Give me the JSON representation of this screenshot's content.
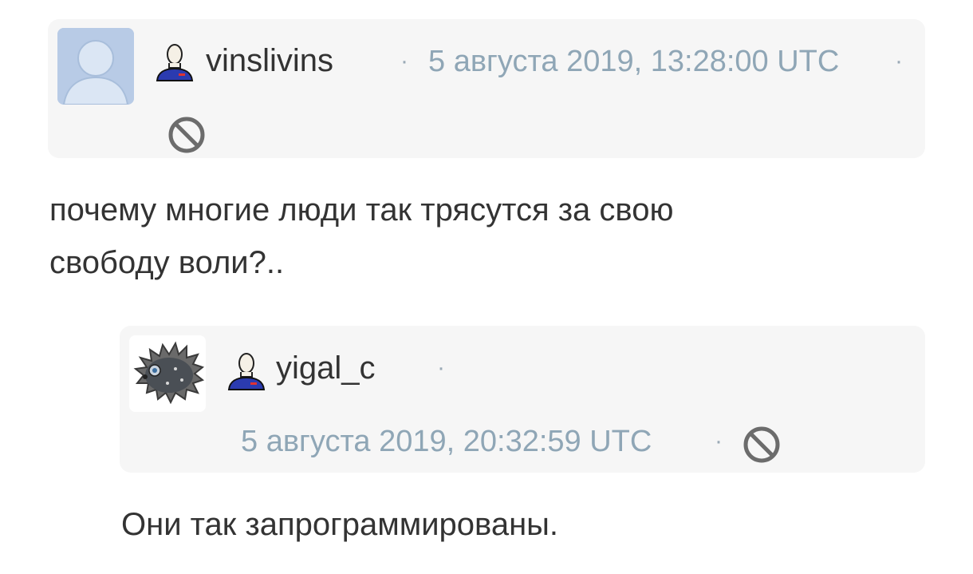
{
  "comments": [
    {
      "username": "vinslivins",
      "separator": "·",
      "date": "5 августа 2019, 13:28:00 UTC",
      "text_line1": "почему многие люди так трясутся за свою",
      "text_line2": "свободу воли?.."
    },
    {
      "username": "yigal_c",
      "separator": "·",
      "date": "5 августа 2019, 20:32:59 UTC",
      "text": "Они так запрограммированы."
    }
  ],
  "colors": {
    "card_bg": "#f6f6f6",
    "meta_text": "#8fa6b6",
    "body_text": "#333333",
    "user_icon_blue": "#2b3bb0",
    "ban_icon": "#6c6c6c"
  },
  "icons": {
    "user": "user-profile-icon",
    "ban": "ban-icon"
  }
}
